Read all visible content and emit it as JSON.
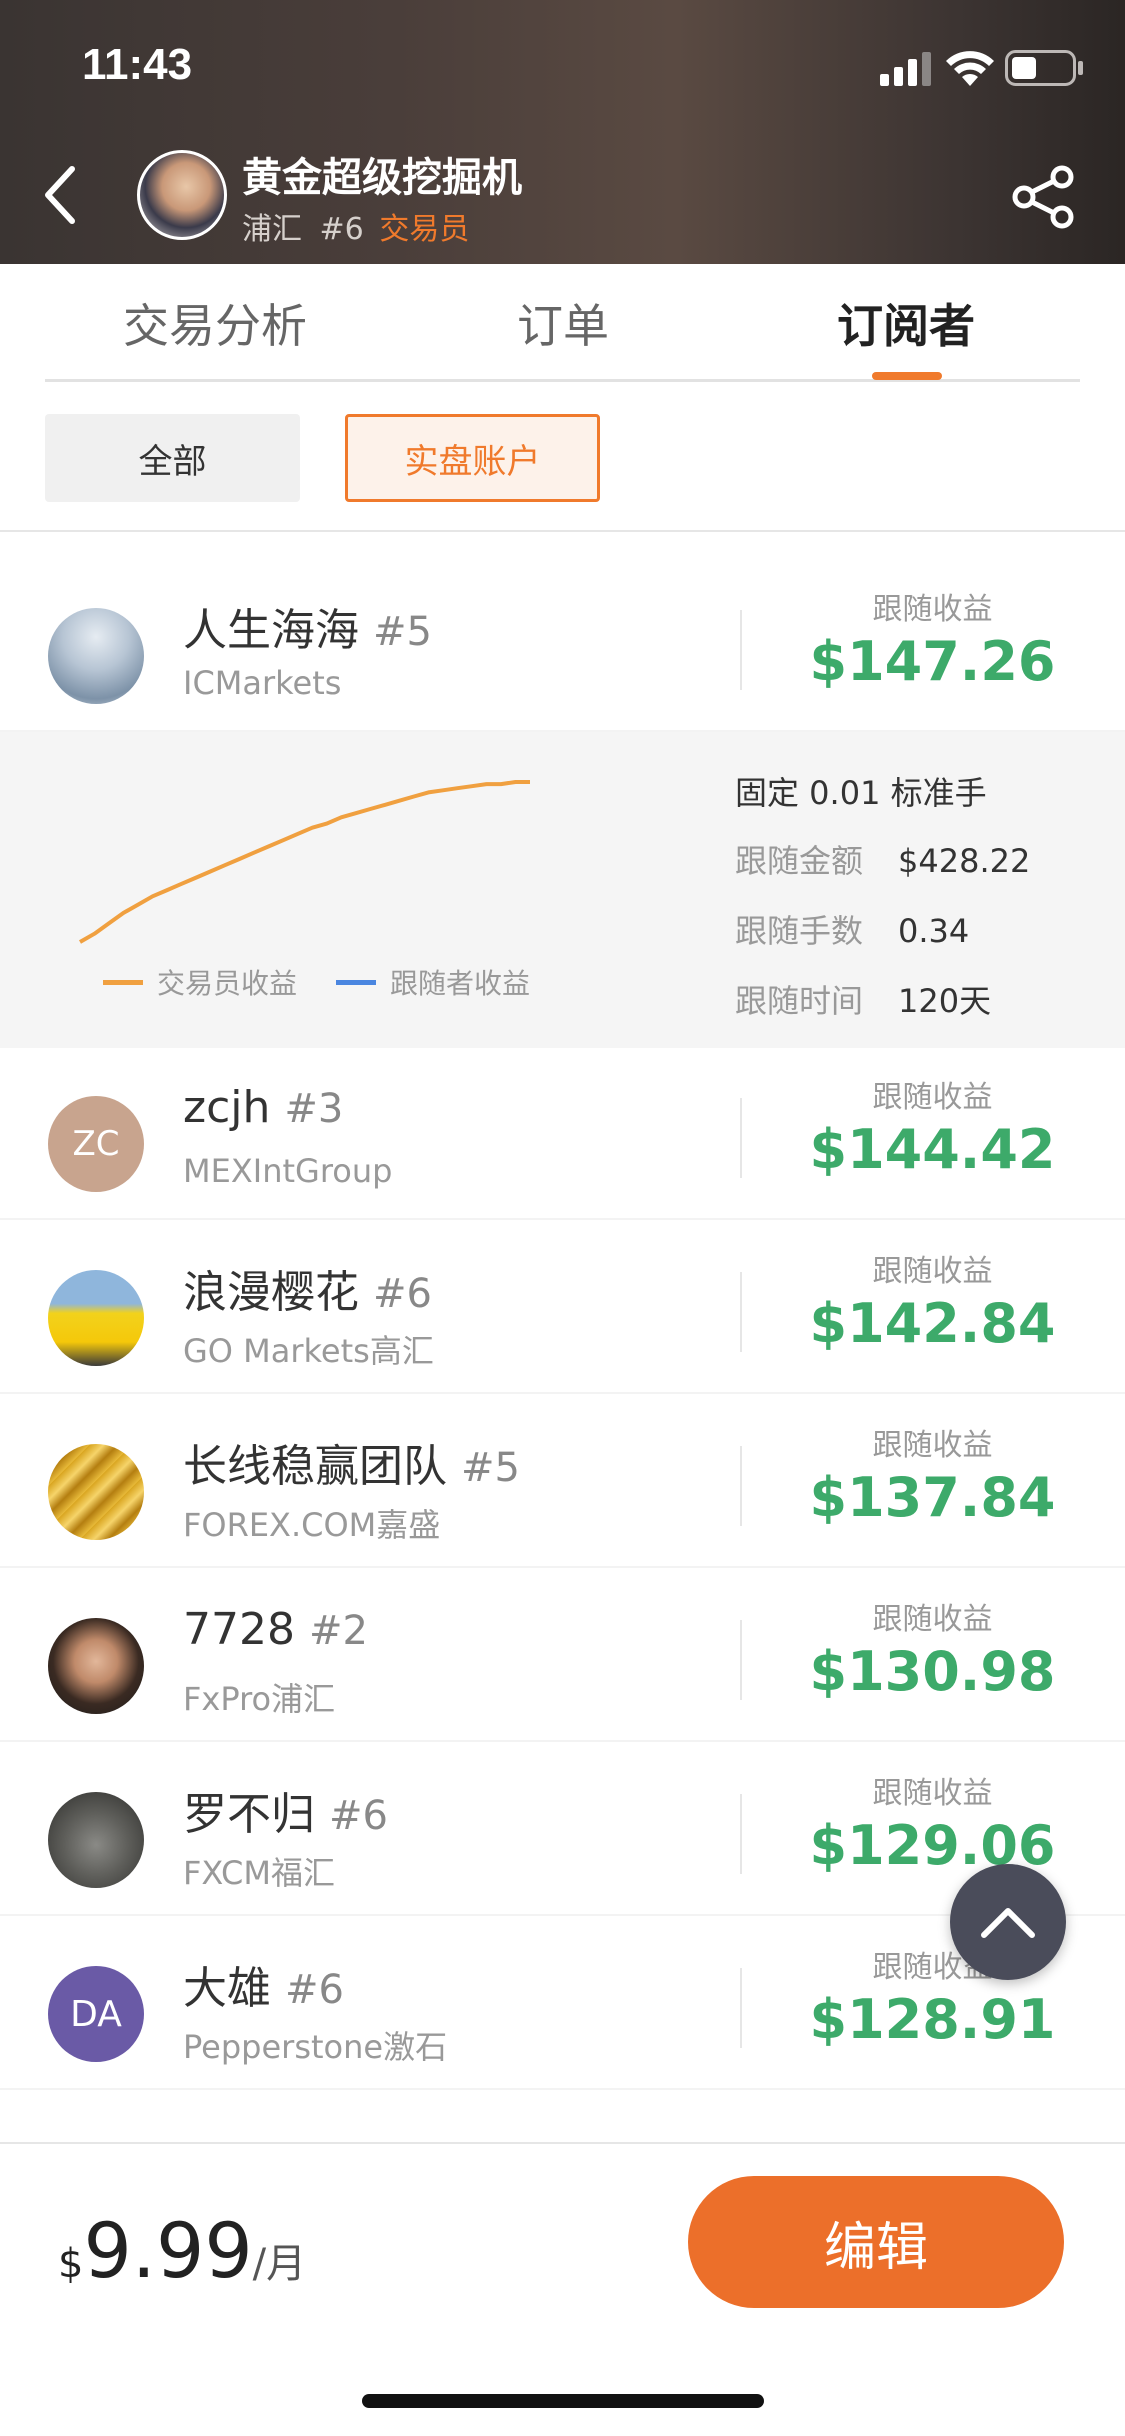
{
  "status_bar": {
    "time": "11:43"
  },
  "header": {
    "title": "黄金超级挖掘机",
    "subtitle_broker": "浦汇",
    "subtitle_rank": "#6",
    "subtitle_role": "交易员"
  },
  "tabs": [
    {
      "label": "交易分析"
    },
    {
      "label": "订单"
    },
    {
      "label": "订阅者",
      "active": true
    }
  ],
  "filters": [
    {
      "label": "全部"
    },
    {
      "label": "实盘账户",
      "selected": true
    }
  ],
  "subscribers": [
    {
      "name": "人生海海",
      "rank": "#5",
      "broker": "ICMarkets",
      "profit_label": "跟随收益",
      "profit": "$147.26",
      "avatar_icon": "photo-avatar"
    },
    {
      "name": "zcjh",
      "rank": "#3",
      "broker": "MEXIntGroup",
      "profit_label": "跟随收益",
      "profit": "$144.42",
      "avatar_text": "ZC",
      "avatar_color": "#c8a48e"
    },
    {
      "name": "浪漫樱花",
      "rank": "#6",
      "broker": "GO Markets高汇",
      "profit_label": "跟随收益",
      "profit": "$142.84",
      "avatar_icon": "car-photo"
    },
    {
      "name": "长线稳赢团队",
      "rank": "#5",
      "broker": "FOREX.COM嘉盛",
      "profit_label": "跟随收益",
      "profit": "$137.84",
      "avatar_icon": "gold-bars-photo"
    },
    {
      "name": "7728",
      "rank": "#2",
      "broker": "FxPro浦汇",
      "profit_label": "跟随收益",
      "profit": "$130.98",
      "avatar_icon": "portrait-photo"
    },
    {
      "name": "罗不归",
      "rank": "#6",
      "broker": "FXCM福汇",
      "profit_label": "跟随收益",
      "profit": "$129.06",
      "avatar_icon": "love-stone-photo"
    },
    {
      "name": "大雄",
      "rank": "#6",
      "broker": "Pepperstone激石",
      "profit_label": "跟随收益",
      "profit": "$128.91",
      "avatar_text": "DA",
      "avatar_color": "#6a5aa6"
    }
  ],
  "detail": {
    "lot_info": "固定 0.01 标准手",
    "rows": [
      {
        "key": "跟随金额",
        "value": "$428.22"
      },
      {
        "key": "跟随手数",
        "value": "0.34"
      },
      {
        "key": "跟随时间",
        "value": "120天"
      }
    ]
  },
  "chart_data": {
    "type": "line",
    "title": "",
    "xlabel": "",
    "ylabel": "",
    "series": [
      {
        "name": "交易员收益",
        "color": "#f0a040",
        "values": [
          0,
          4,
          9,
          14,
          18,
          22,
          25,
          28,
          31,
          34,
          37,
          40,
          43,
          46,
          49,
          52,
          55,
          57,
          60,
          62,
          64,
          66,
          68,
          70,
          72,
          73,
          74,
          75,
          76,
          76,
          77,
          77
        ]
      },
      {
        "name": "跟随者收益",
        "color": "#4a86e0",
        "values": []
      }
    ]
  },
  "bottom_bar": {
    "currency": "$",
    "price": "9.99",
    "unit": "/月",
    "edit_label": "编辑"
  },
  "colors": {
    "accent": "#ec6f2a",
    "profit_green": "#3daa6a"
  }
}
